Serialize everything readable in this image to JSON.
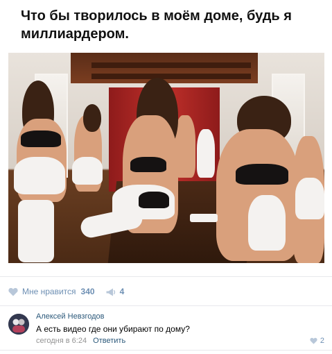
{
  "post": {
    "title": "Что бы творилось в моём доме, будь я миллиардером."
  },
  "actions": {
    "like_label": "Мне нравится",
    "like_count": "340",
    "share_count": "4"
  },
  "comment": {
    "author": "Алексей Невзгодов",
    "text": "А есть видео где они убирают по дому?",
    "time": "сегодня в 6:24",
    "reply_label": "Ответить",
    "like_count": "2"
  },
  "colors": {
    "link": "#2b587a",
    "action": "#6d8fb3",
    "meta": "#939393",
    "divider": "#e7e8ec"
  }
}
